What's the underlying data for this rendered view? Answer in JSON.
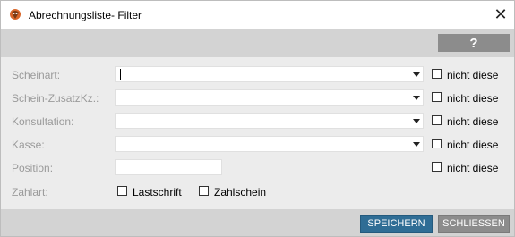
{
  "window": {
    "title": "Abrechnungsliste- Filter",
    "close_glyph": "✕",
    "app_icon": "app-logo-icon"
  },
  "toolbar": {
    "help_label": "?"
  },
  "form": {
    "rows": [
      {
        "label": "Scheinart:",
        "value": "",
        "exclude_label": "nicht diese",
        "exclude_checked": false
      },
      {
        "label": "Schein-ZusatzKz.:",
        "value": "",
        "exclude_label": "nicht diese",
        "exclude_checked": false
      },
      {
        "label": "Konsultation:",
        "value": "",
        "exclude_label": "nicht diese",
        "exclude_checked": false
      },
      {
        "label": "Kasse:",
        "value": "",
        "exclude_label": "nicht diese",
        "exclude_checked": false
      },
      {
        "label": "Position:",
        "value": "",
        "exclude_label": "nicht diese",
        "exclude_checked": false
      }
    ],
    "zahlart": {
      "label": "Zahlart:",
      "options": [
        {
          "label": "Lastschrift",
          "checked": false
        },
        {
          "label": "Zahlschein",
          "checked": false
        }
      ]
    }
  },
  "footer": {
    "save_label": "SPEICHERN",
    "close_label": "SCHLIESSEN"
  },
  "colors": {
    "primary_button": "#2f6d95",
    "secondary_button": "#8c8c8c",
    "strip": "#d3d3d3",
    "panel": "#ececec"
  }
}
